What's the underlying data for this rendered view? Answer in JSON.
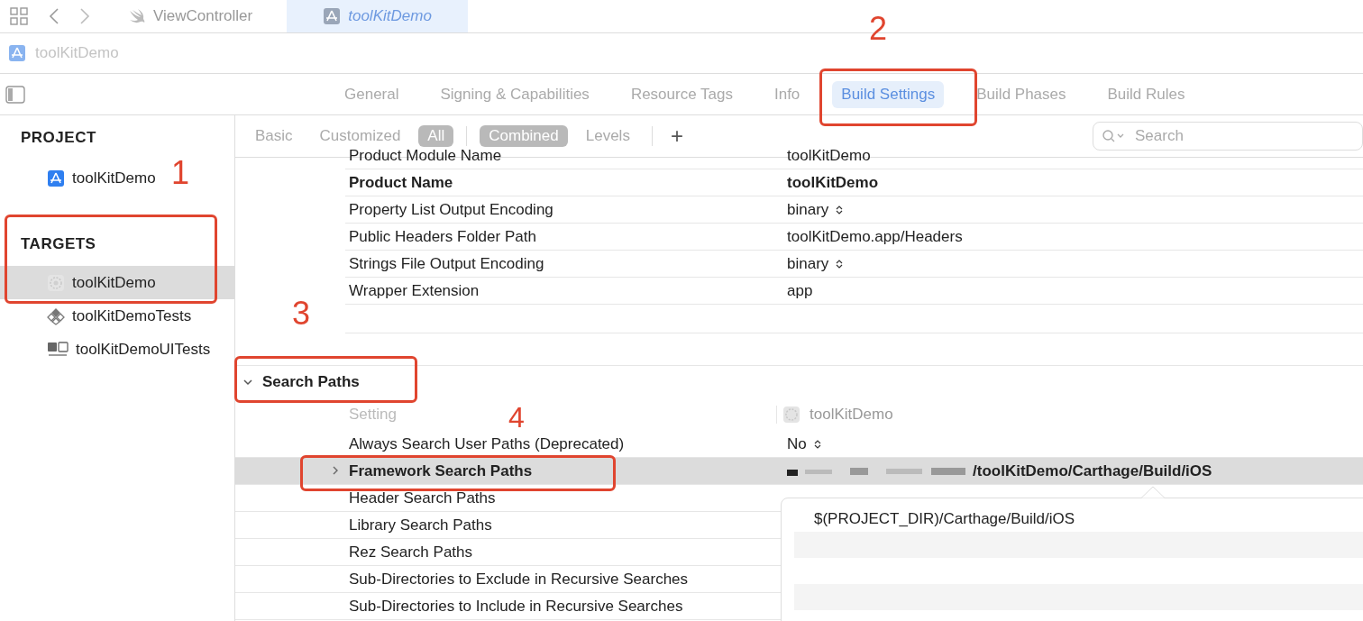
{
  "file_tabs": [
    {
      "label": "ViewController",
      "kind": "swift",
      "selected": false
    },
    {
      "label": "toolKitDemo",
      "kind": "app",
      "selected": true
    }
  ],
  "breadcrumb": "toolKitDemo",
  "editor_tabs": [
    {
      "label": "General",
      "selected": false
    },
    {
      "label": "Signing & Capabilities",
      "selected": false
    },
    {
      "label": "Resource Tags",
      "selected": false
    },
    {
      "label": "Info",
      "selected": false
    },
    {
      "label": "Build Settings",
      "selected": true
    },
    {
      "label": "Build Phases",
      "selected": false
    },
    {
      "label": "Build Rules",
      "selected": false
    }
  ],
  "sidebar": {
    "sections": [
      {
        "title": "PROJECT",
        "items": [
          {
            "label": "toolKitDemo",
            "kind": "app",
            "selected": false
          }
        ]
      },
      {
        "title": "TARGETS",
        "items": [
          {
            "label": "toolKitDemo",
            "kind": "target",
            "selected": true
          },
          {
            "label": "toolKitDemoTests",
            "kind": "tests",
            "selected": false
          },
          {
            "label": "toolKitDemoUITests",
            "kind": "uitests",
            "selected": false
          }
        ]
      }
    ]
  },
  "filters": {
    "scope": [
      {
        "label": "Basic",
        "selected": false
      },
      {
        "label": "Customized",
        "selected": false
      },
      {
        "label": "All",
        "selected": true
      }
    ],
    "view": [
      {
        "label": "Combined",
        "selected": true
      },
      {
        "label": "Levels",
        "selected": false
      }
    ],
    "add": "+",
    "search": {
      "placeholder": "Search"
    }
  },
  "top_rows": [
    {
      "setting": "Product Module Name",
      "value": "toolKitDemo",
      "kind": "text",
      "bold": false
    },
    {
      "setting": "Product Name",
      "value": "toolKitDemo",
      "kind": "text",
      "bold": true
    },
    {
      "setting": "Property List Output Encoding",
      "value": "binary",
      "kind": "popup",
      "bold": false
    },
    {
      "setting": "Public Headers Folder Path",
      "value": "toolKitDemo.app/Headers",
      "kind": "text",
      "bold": false
    },
    {
      "setting": "Strings File Output Encoding",
      "value": "binary",
      "kind": "popup",
      "bold": false
    },
    {
      "setting": "Wrapper Extension",
      "value": "app",
      "kind": "text",
      "bold": false
    }
  ],
  "section": {
    "title": "Search Paths",
    "expanded": true,
    "column_setting": "Setting",
    "column_target": "toolKitDemo",
    "rows": [
      {
        "setting": "Always Search User Paths (Deprecated)",
        "value": "No",
        "kind": "popup",
        "bold": false,
        "selected": false
      },
      {
        "setting": "Framework Search Paths",
        "value": "/toolKitDemo/Carthage/Build/iOS",
        "kind": "redacted",
        "bold": true,
        "selected": true,
        "expanded": false
      },
      {
        "setting": "Header Search Paths",
        "bold": false,
        "selected": false
      },
      {
        "setting": "Library Search Paths",
        "bold": false,
        "selected": false
      },
      {
        "setting": "Rez Search Paths",
        "bold": false,
        "selected": false
      },
      {
        "setting": "Sub-Directories to Exclude in Recursive Searches",
        "bold": false,
        "selected": false
      },
      {
        "setting": "Sub-Directories to Include in Recursive Searches",
        "bold": false,
        "selected": false
      }
    ]
  },
  "popover": {
    "entries": [
      "$(PROJECT_DIR)/Carthage/Build/iOS"
    ]
  },
  "annotations": [
    {
      "label": "1"
    },
    {
      "label": "2"
    },
    {
      "label": "3"
    },
    {
      "label": "4"
    }
  ]
}
